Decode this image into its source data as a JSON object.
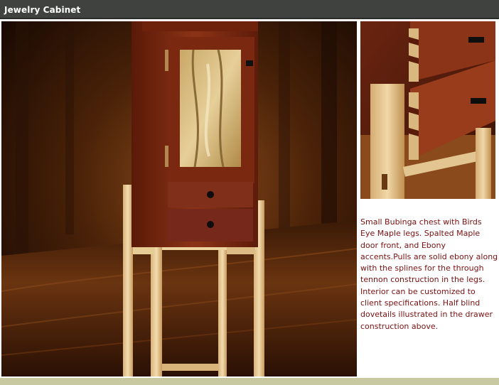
{
  "header": {
    "title": "Jewelry Cabinet"
  },
  "main_photo": {
    "subject": "jewelry cabinet photograph"
  },
  "detail_photo": {
    "subject": "dovetail drawer detail photograph"
  },
  "description": {
    "text": "Small Bubinga chest with Birds Eye Maple legs. Spalted Maple door front, and Ebony accents.Pulls are solid ebony along with the splines for the through tennon construction in the legs. Interior can be customized to client specifications. Half blind dovetails illustrated in the drawer construction above."
  },
  "colors": {
    "header_bg": "#3f423e",
    "header_text": "#ffffff",
    "description_text": "#7a1010",
    "footer_bar": "#c8c9a0"
  }
}
